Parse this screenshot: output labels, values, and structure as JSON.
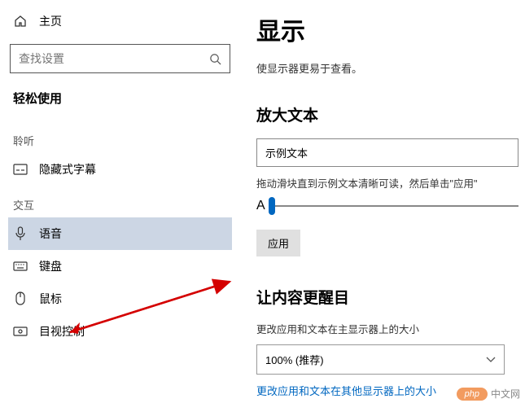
{
  "sidebar": {
    "home": "主页",
    "search_placeholder": "查找设置",
    "title": "轻松使用",
    "sections": {
      "listen": {
        "label": "聆听",
        "items": [
          {
            "label": "隐藏式字幕"
          }
        ]
      },
      "interact": {
        "label": "交互",
        "items": [
          {
            "label": "语音"
          },
          {
            "label": "键盘"
          },
          {
            "label": "鼠标"
          },
          {
            "label": "目视控制"
          }
        ]
      }
    }
  },
  "main": {
    "title": "显示",
    "desc": "使显示器更易于查看。",
    "enlarge": {
      "heading": "放大文本",
      "sample": "示例文本",
      "hint": "拖动滑块直到示例文本清晰可读，然后单击\"应用\"",
      "small_a": "A",
      "apply": "应用"
    },
    "prominent": {
      "heading": "让内容更醒目",
      "change_label": "更改应用和文本在主显示器上的大小",
      "scale_value": "100% (推荐)",
      "link": "更改应用和文本在其他显示器上的大小"
    }
  },
  "watermark": {
    "badge": "php",
    "text": "中文网"
  }
}
